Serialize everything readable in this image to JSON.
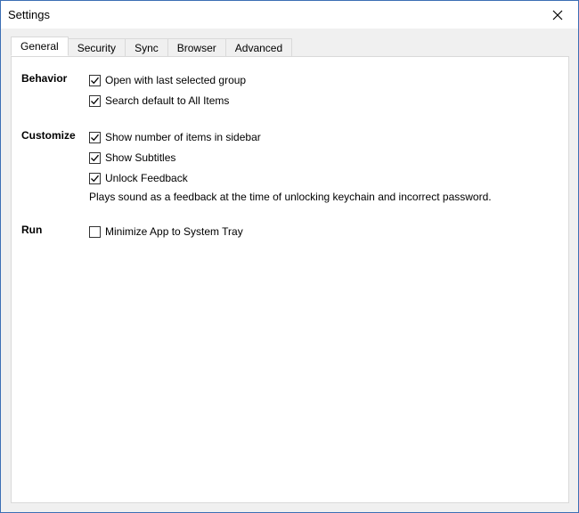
{
  "window": {
    "title": "Settings"
  },
  "tabs": [
    {
      "label": "General",
      "active": true
    },
    {
      "label": "Security",
      "active": false
    },
    {
      "label": "Sync",
      "active": false
    },
    {
      "label": "Browser",
      "active": false
    },
    {
      "label": "Advanced",
      "active": false
    }
  ],
  "behavior": {
    "heading": "Behavior",
    "items": [
      {
        "label": "Open with last selected group",
        "checked": true
      },
      {
        "label": "Search default to All Items",
        "checked": true
      }
    ]
  },
  "customize": {
    "heading": "Customize",
    "items": [
      {
        "label": "Show number of items in sidebar",
        "checked": true
      },
      {
        "label": "Show Subtitles",
        "checked": true
      },
      {
        "label": "Unlock Feedback",
        "checked": true
      }
    ],
    "description": "Plays sound as a feedback at the time of unlocking keychain and incorrect password."
  },
  "run": {
    "heading": "Run",
    "items": [
      {
        "label": "Minimize App to System Tray",
        "checked": false
      }
    ]
  },
  "icons": {
    "close": "close-icon",
    "check": "checkmark-icon"
  }
}
